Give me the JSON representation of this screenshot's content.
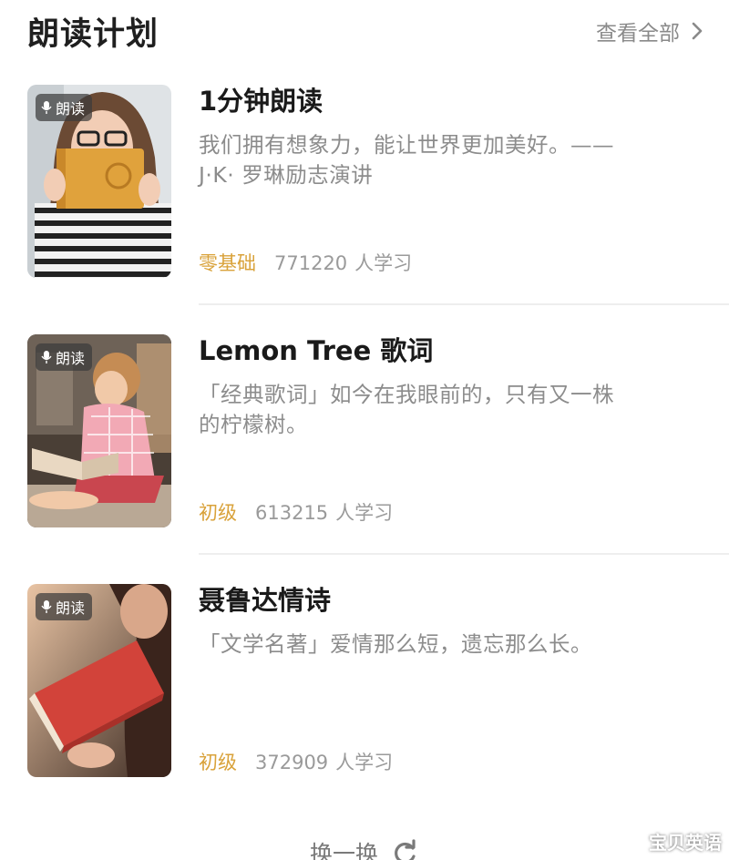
{
  "header": {
    "title": "朗读计划",
    "see_all_label": "查看全部"
  },
  "badge_label": "朗读",
  "plans": [
    {
      "title": "1分钟朗读",
      "desc_line1": "我们拥有想象力，能让世界更加美好。——",
      "desc_line2": "J·K· 罗琳励志演讲",
      "level": "零基础",
      "learners": "771220",
      "learners_unit": "人学习"
    },
    {
      "title": "Lemon Tree 歌词",
      "desc_line1": "「经典歌词」如今在我眼前的，只有又一株",
      "desc_line2": "的柠檬树。",
      "level": "初级",
      "learners": "613215",
      "learners_unit": "人学习"
    },
    {
      "title": "聂鲁达情诗",
      "desc_line1": "「文学名著」爱情那么短，遗忘那么长。",
      "desc_line2": "",
      "level": "初级",
      "learners": "372909",
      "learners_unit": "人学习"
    }
  ],
  "refresh_label": "换一换",
  "watermark": "宝贝英语",
  "colors": {
    "accent_level": "#d9a23a",
    "title": "#1a1a1a",
    "secondary_text": "#8c8c8c"
  },
  "icons": {
    "see_all": "chevron-right-icon",
    "badge": "microphone-icon",
    "refresh": "refresh-icon"
  }
}
